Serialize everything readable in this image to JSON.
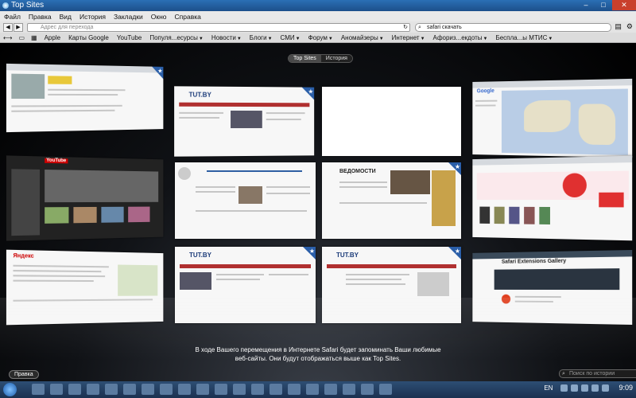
{
  "window": {
    "title": "Top Sites",
    "controls": [
      "–",
      "□",
      "✕"
    ]
  },
  "menubar": {
    "items": [
      "Файл",
      "Правка",
      "Вид",
      "История",
      "Закладки",
      "Окно",
      "Справка"
    ]
  },
  "toolbar": {
    "address_placeholder": "Адрес для перехода",
    "search_value": "safari скачать",
    "icons": [
      "back-icon",
      "forward-icon",
      "refresh-icon",
      "search-icon",
      "page-menu-icon",
      "settings-gear-icon"
    ]
  },
  "bookmarks": {
    "items": [
      {
        "label": "Apple",
        "menu": false
      },
      {
        "label": "Карты Google",
        "menu": false
      },
      {
        "label": "YouTube",
        "menu": false
      },
      {
        "label": "Популя...есурсы",
        "menu": true
      },
      {
        "label": "Новости",
        "menu": true
      },
      {
        "label": "Блоги",
        "menu": true
      },
      {
        "label": "СМИ",
        "menu": true
      },
      {
        "label": "Форум",
        "menu": true
      },
      {
        "label": "Аномайзеры",
        "menu": true
      },
      {
        "label": "Интернет",
        "menu": true
      },
      {
        "label": "Афориз...екдоты",
        "menu": true
      },
      {
        "label": "Беспла...ы МТИС",
        "menu": true
      }
    ]
  },
  "topsites": {
    "segmented": [
      "Top Sites",
      "История"
    ],
    "active_segment": "Top Sites",
    "thumbnails": [
      {
        "name": "top-site-1",
        "logo": "",
        "accent": "#b02020"
      },
      {
        "name": "top-site-2",
        "logo": "TUT.BY",
        "accent": "#1b3b79"
      },
      {
        "name": "top-site-3",
        "logo": "",
        "accent": "#ffffff"
      },
      {
        "name": "top-site-4",
        "logo": "Google",
        "accent": "#7a9fd0"
      },
      {
        "name": "top-site-5",
        "logo": "YouTube",
        "accent": "#cc0000"
      },
      {
        "name": "top-site-6",
        "logo": "",
        "accent": "#3366aa"
      },
      {
        "name": "top-site-7",
        "logo": "ВЕДОМОСТИ",
        "accent": "#c8a24a"
      },
      {
        "name": "top-site-8",
        "logo": "",
        "accent": "#e03030"
      },
      {
        "name": "top-site-9",
        "logo": "Яндекс",
        "accent": "#cc0000"
      },
      {
        "name": "top-site-10",
        "logo": "TUT.BY",
        "accent": "#1b3b79"
      },
      {
        "name": "top-site-11",
        "logo": "TUT.BY",
        "accent": "#1b3b79"
      },
      {
        "name": "top-site-12",
        "logo": "Safari Extensions Gallery",
        "accent": "#3a4a5a"
      }
    ],
    "message_line1": "В ходе Вашего перемещения в Интернете Safari будет запоминать Ваши любимые",
    "message_line2": "веб-сайты. Они будут отображаться выше как Top Sites.",
    "edit_label": "Правка",
    "history_search_placeholder": "Поиск по истории"
  },
  "taskbar": {
    "language": "EN",
    "clock": "9:09"
  }
}
